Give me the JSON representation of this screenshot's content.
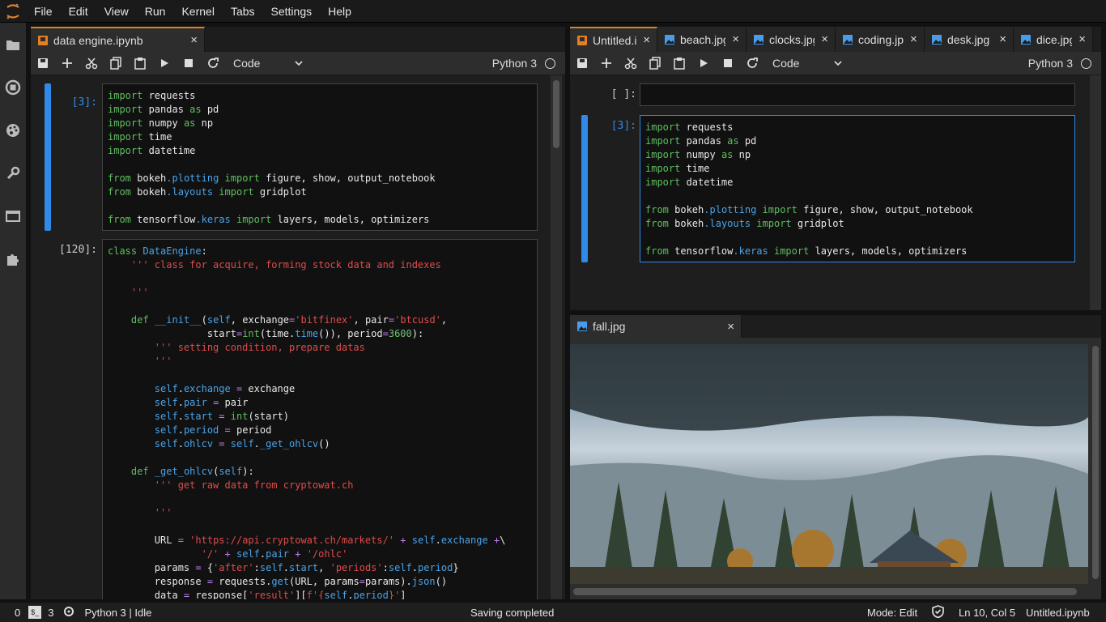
{
  "menu": {
    "items": [
      "File",
      "Edit",
      "View",
      "Run",
      "Kernel",
      "Tabs",
      "Settings",
      "Help"
    ]
  },
  "left_panel": {
    "tab": {
      "label": "data engine.ipynb",
      "close": "×"
    },
    "toolbar": {
      "cell_type": "Code",
      "kernel": "Python 3"
    },
    "cells": [
      {
        "prompt": "[3]:",
        "code": "<span class=k>import</span> requests\n<span class=k>import</span> pandas <span class=k>as</span> pd\n<span class=k>import</span> numpy <span class=k>as</span> np\n<span class=k>import</span> time\n<span class=k>import</span> datetime\n\n<span class=k>from</span> bokeh<span class=b>.plotting</span> <span class=k>import</span> figure, show, output_notebook\n<span class=k>from</span> bokeh<span class=b>.layouts</span> <span class=k>import</span> gridplot\n\n<span class=k>from</span> tensorflow<span class=b>.keras</span> <span class=k>import</span> layers, models, optimizers"
      },
      {
        "prompt": "[120]:",
        "code": "<span class=k>class</span> <span class=b>DataEngine</span>:\n    <span class=s>''' class for acquire, forming stock data and indexes</span>\n\n    <span class=s>'''</span>\n\n    <span class=k>def</span> <span class=b>__init__</span>(<span class=b>self</span>, exchange<span class=o>=</span><span class=s>'bitfinex'</span>, pair<span class=o>=</span><span class=s>'btcusd'</span>,\n                 start<span class=o>=</span><span class=k>int</span>(time.<span class=b>time</span>()), period<span class=o>=</span><span class=n>3600</span>):\n        <span class=s>''' setting condition, prepare datas</span>\n        <span class=s>'''</span>\n\n        <span class=b>self</span>.<span class=b>exchange</span> <span class=o>=</span> exchange\n        <span class=b>self</span>.<span class=b>pair</span> <span class=o>=</span> pair\n        <span class=b>self</span>.<span class=b>start</span> <span class=o>=</span> <span class=k>int</span>(start)\n        <span class=b>self</span>.<span class=b>period</span> <span class=o>=</span> period\n        <span class=b>self</span>.<span class=b>ohlcv</span> <span class=o>=</span> <span class=b>self</span>.<span class=b>_get_ohlcv</span>()\n\n    <span class=k>def</span> <span class=b>_get_ohlcv</span>(<span class=b>self</span>):\n        <span class=s>''' get raw data from cryptowat.ch</span>\n\n        <span class=s>'''</span>\n\n        URL <span class=o>=</span> <span class=s>'https://api.cryptowat.ch/markets/'</span> <span class=o>+</span> <span class=b>self</span>.<span class=b>exchange</span> <span class=o>+</span>\\\n                <span class=s>'/'</span> <span class=o>+</span> <span class=b>self</span>.<span class=b>pair</span> <span class=o>+</span> <span class=s>'/ohlc'</span>\n        params <span class=o>=</span> {<span class=s>'after'</span>:<span class=b>self</span>.<span class=b>start</span>, <span class=s>'periods'</span>:<span class=b>self</span>.<span class=b>period</span>}\n        response <span class=o>=</span> requests.<span class=b>get</span>(URL, params<span class=o>=</span>params).<span class=b>json</span>()\n        data <span class=o>=</span> response[<span class=s>'result'</span>][<span class=s>f'{</span><span class=b>self</span>.<span class=b>period</span><span class=s>}'</span>]"
      }
    ]
  },
  "right_panel": {
    "tabs": [
      {
        "label": "Untitled.ipynb"
      },
      {
        "label": "beach.jpg"
      },
      {
        "label": "clocks.jpg"
      },
      {
        "label": "coding.jpg"
      },
      {
        "label": "desk.jpg"
      },
      {
        "label": "dice.jpg"
      }
    ],
    "toolbar": {
      "cell_type": "Code",
      "kernel": "Python 3"
    },
    "empty_prompt": "[ ]:",
    "cell": {
      "prompt": "[3]:",
      "code": "<span class=k>import</span> requests\n<span class=k>import</span> pandas <span class=k>as</span> pd\n<span class=k>import</span> numpy <span class=k>as</span> np\n<span class=k>import</span> time\n<span class=k>import</span> datetime\n\n<span class=k>from</span> bokeh<span class=b>.plotting</span> <span class=k>import</span> figure, show, output_notebook\n<span class=k>from</span> bokeh<span class=b>.layouts</span> <span class=k>import</span> gridplot\n\n<span class=k>from</span> tensorflow<span class=b>.keras</span> <span class=k>import</span> layers, models, optimizers"
    }
  },
  "image_panel": {
    "tab": {
      "label": "fall.jpg"
    }
  },
  "status": {
    "terminals": "0",
    "kernels": "3",
    "kernel_status": "Python 3 | Idle",
    "message": "Saving completed",
    "mode": "Mode: Edit",
    "position": "Ln 10, Col 5",
    "file": "Untitled.ipynb"
  },
  "colors": {
    "accent": "#2f8ae8",
    "orange": "#e67e22"
  }
}
